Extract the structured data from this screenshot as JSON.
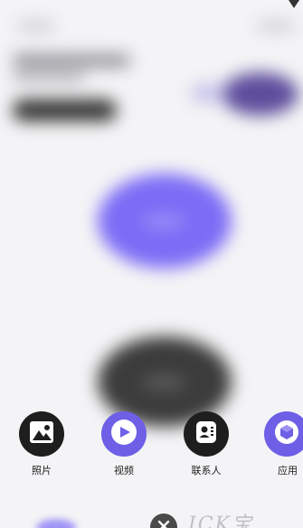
{
  "background": {
    "blurred": true,
    "accent_color": "#7c6cf6",
    "dark_color": "#3c3c3c",
    "secondary_accent": "#5d4e9c"
  },
  "share_sheet": {
    "items": [
      {
        "label": "照片",
        "icon": "photo-icon",
        "circle_color": "#1e1e1e"
      },
      {
        "label": "视频",
        "icon": "play-icon",
        "circle_color": "#6e5fe6"
      },
      {
        "label": "联系人",
        "icon": "contact-icon",
        "circle_color": "#1e1e1e"
      },
      {
        "label": "应用",
        "icon": "app-cube-icon",
        "circle_color": "#6e5fe6"
      }
    ]
  },
  "bottom": {
    "close_icon": "close-icon",
    "watermark_text": "ICK宝"
  }
}
